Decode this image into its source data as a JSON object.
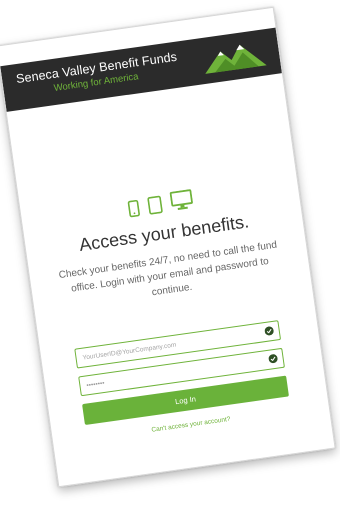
{
  "brand": {
    "name": "Seneca Valley Benefit Funds",
    "tagline": "Working for America",
    "accent_color": "#6fb33a",
    "header_bg": "#2b2b2b"
  },
  "devices": {
    "icons": [
      "phone-icon",
      "tablet-icon",
      "desktop-icon"
    ]
  },
  "hero": {
    "heading": "Access your benefits.",
    "subtext": "Check your benefits 24/7, no need to call the fund office. Login with your email and password to continue."
  },
  "form": {
    "email_placeholder": "YourUserID@YourCompany.com",
    "password_value": "••••••••",
    "login_label": "Log In",
    "forgot_link": "Can't access your account?"
  }
}
